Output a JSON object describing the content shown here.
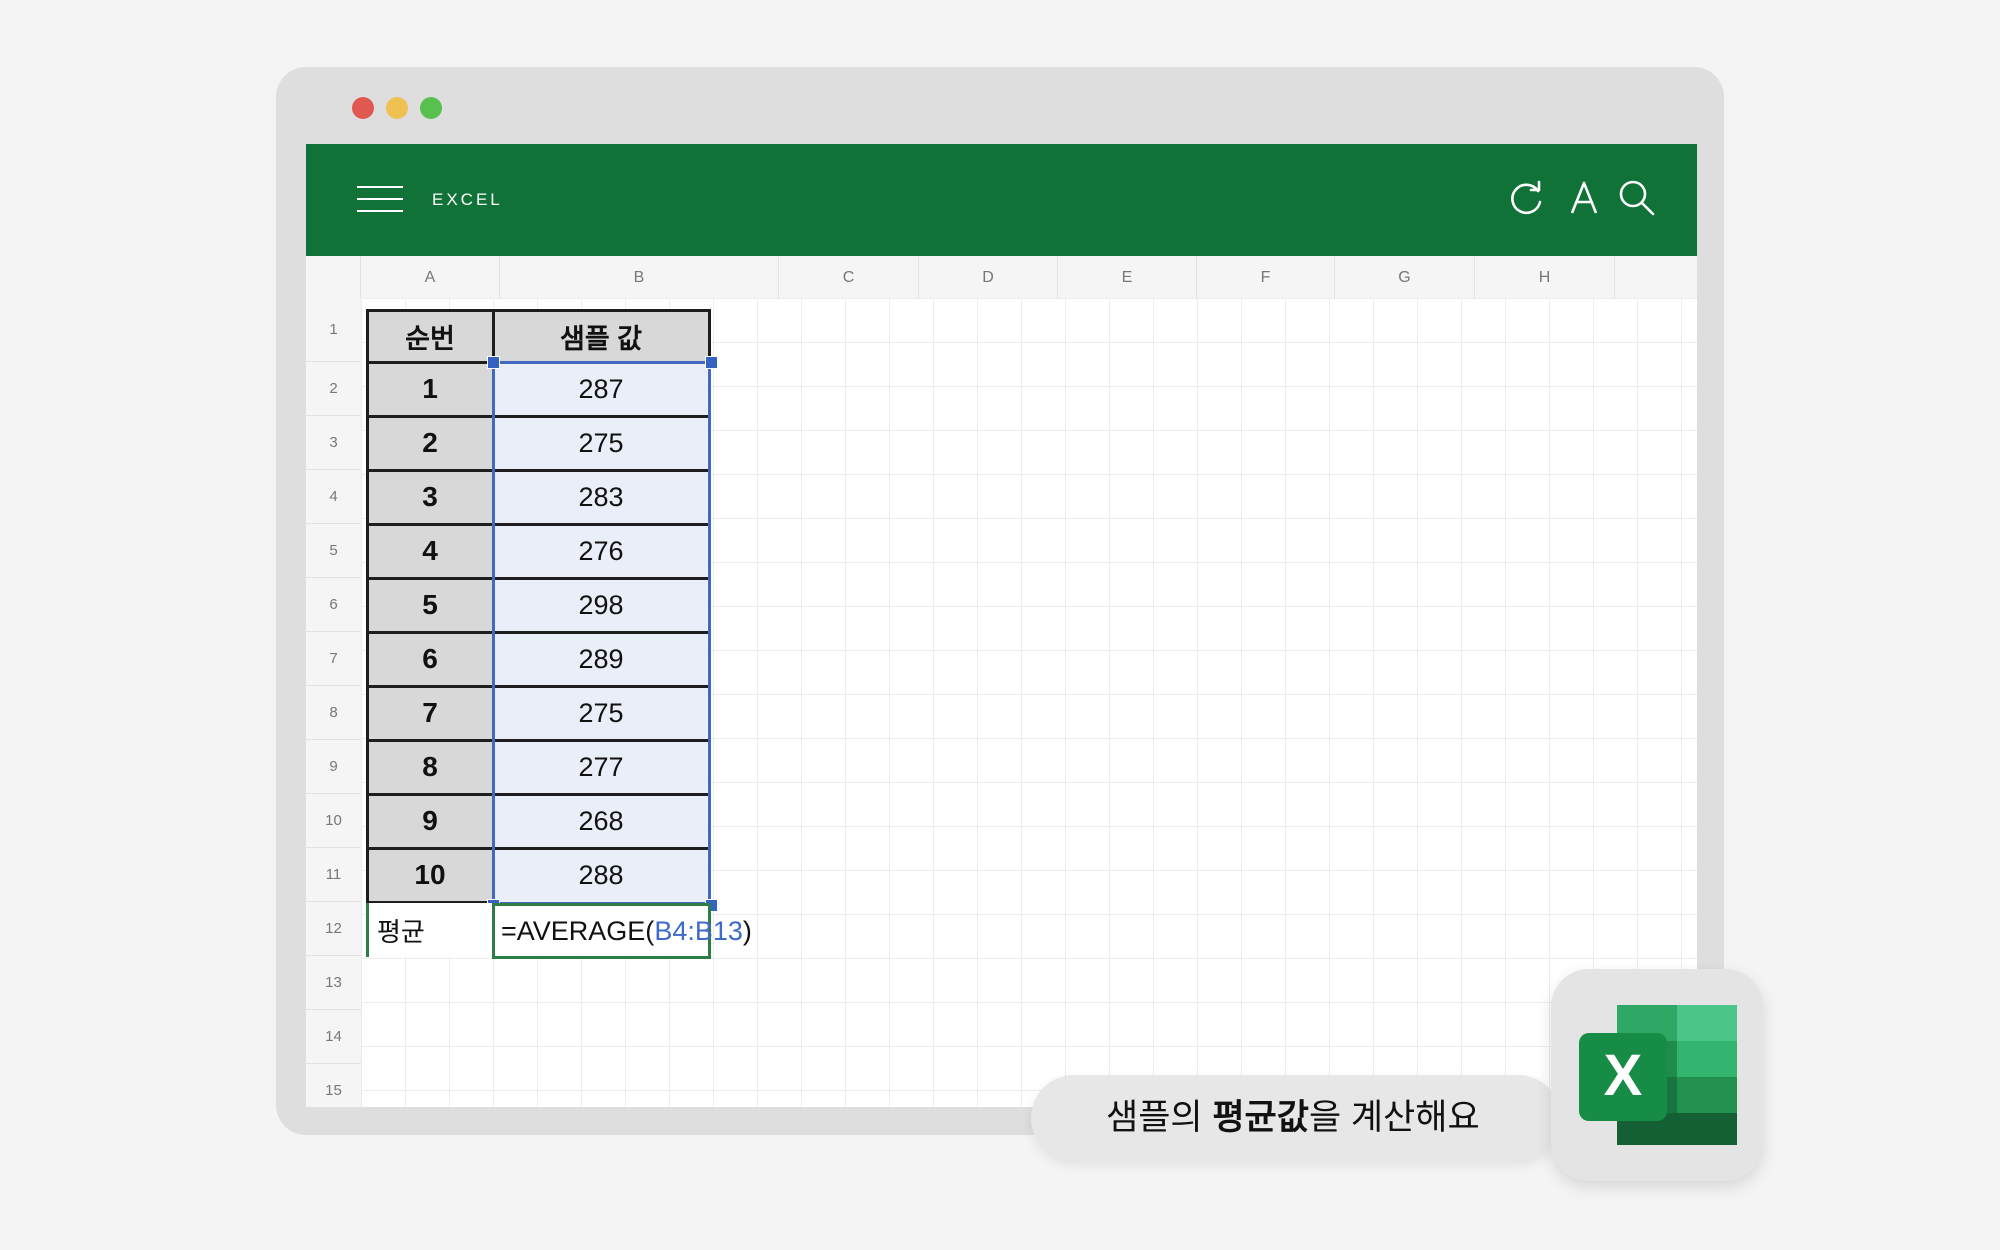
{
  "window": {
    "buttons": [
      "close",
      "minimize",
      "maximize"
    ]
  },
  "toolbar": {
    "title": "EXCEL",
    "icons": [
      "menu-icon",
      "refresh-icon",
      "font-icon",
      "search-icon"
    ]
  },
  "columns": [
    "A",
    "B",
    "C",
    "D",
    "E",
    "F",
    "G",
    "H"
  ],
  "rows": [
    "1",
    "2",
    "3",
    "4",
    "5",
    "6",
    "7",
    "8",
    "9",
    "10",
    "11",
    "12",
    "13",
    "14",
    "15"
  ],
  "table": {
    "header": {
      "index": "순번",
      "value": "샘플 값"
    },
    "data": [
      {
        "index": "1",
        "value": "287"
      },
      {
        "index": "2",
        "value": "275"
      },
      {
        "index": "3",
        "value": "283"
      },
      {
        "index": "4",
        "value": "276"
      },
      {
        "index": "5",
        "value": "298"
      },
      {
        "index": "6",
        "value": "289"
      },
      {
        "index": "7",
        "value": "275"
      },
      {
        "index": "8",
        "value": "277"
      },
      {
        "index": "9",
        "value": "268"
      },
      {
        "index": "10",
        "value": "288"
      }
    ],
    "average_label": "평균",
    "formula_prefix": "=AVERAGE(",
    "formula_ref": "B4:B13",
    "formula_suffix": ")"
  },
  "caption": {
    "pre": "샘플의 ",
    "bold": "평균값",
    "post": "을 계산해요"
  },
  "badge": {
    "letter": "X",
    "icon": "excel-app-icon"
  },
  "colors": {
    "toolbar": "#107237",
    "selection": "#4169c0",
    "active_cell": "#2e7d46",
    "header_fill": "#d8d8d8",
    "selected_fill": "#eaeef8"
  }
}
